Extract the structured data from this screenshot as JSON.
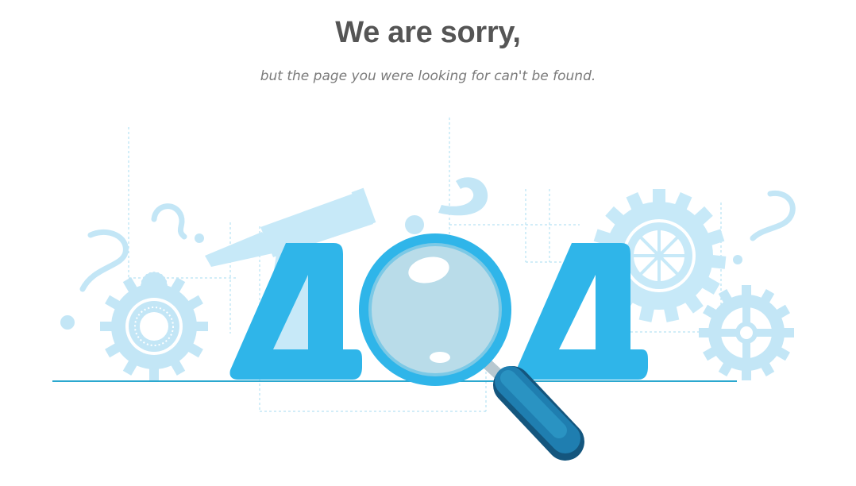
{
  "heading": {
    "title": "We are sorry,",
    "subtitle": "but the page you were looking for can't be found."
  },
  "illustration": {
    "code_digits": [
      "4",
      "4"
    ],
    "icons": [
      "gear-icon",
      "question-mark-icon",
      "telescope-icon",
      "magnifying-glass-icon"
    ],
    "colors": {
      "primary_blue": "#2fb5e9",
      "light_blue": "#c7e9f8",
      "dark_blue": "#1b6b9a",
      "lens": "#b9dce9",
      "ground_line": "#2ba8cf"
    }
  }
}
